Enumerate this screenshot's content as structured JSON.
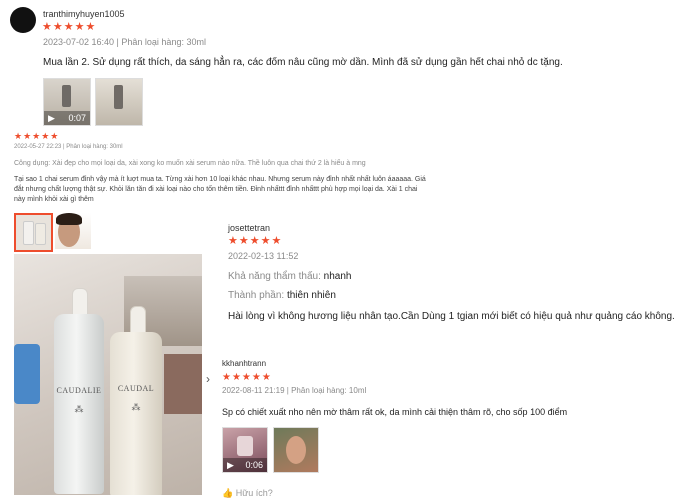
{
  "review1": {
    "username": "tranthimyhuyen1005",
    "stars": "★★★★★",
    "meta": "2023-07-02 16:40 | Phân loại hàng: 30ml",
    "text": "Mua lần 2. Sử dụng rất thích, da sáng hẳn ra, các đốm nâu cũng mờ dần. Mình đã sử dụng gần hết chai nhỏ dc tặng.",
    "video_duration": "0:07"
  },
  "review2": {
    "stars": "★★★★★",
    "meta": "2022-05-27 22:23 | Phân loại hàng: 30ml",
    "line1": "Công dụng: Xài đẹp cho mọi loại da, xài xong ko muốn xài serum nào nữa. Thề luôn qua chai thứ 2 là hiểu à mng",
    "line2": "Tại sao 1 chai serum đỉnh vậy mà ít luợt mua ta. Từng xài hơn 10 loại khác nhau. Nhưng serum này đỉnh nhất nhất luôn áaaaaa. Giá",
    "line3": "đắt nhưng chất lượng thật sự. Khỏi lăn tăn đi xài loại nào cho tốn thêm tiền. Đỉnh nhấttt đỉnh nhấttt phù hợp mọi loại da. Xài 1 chai",
    "line4": "này mình khỏi xài gì thêm",
    "product_brand": "CAUDALIE",
    "product_brand2": "CAUDAL"
  },
  "review3": {
    "username": "josettetran",
    "stars": "★★★★★",
    "date": "2022-02-13 11:52",
    "absorb_label": "Khả năng thẩm thấu:",
    "absorb_value": "nhanh",
    "ingredient_label": "Thành phần:",
    "ingredient_value": "thiên nhiên",
    "text": "Hài lòng vì không hương liệu nhân tạo.Cần Dùng 1 tgian mới biết có hiệu quả như quảng cáo không."
  },
  "review4": {
    "username": "kkhanhtrann",
    "stars": "★★★★★",
    "meta": "2022-08-11 21:19 | Phân loại hàng: 10ml",
    "text": "Sp có chiết xuất nho nên mờ thâm rất ok, da mình cải thiện thâm rõ, cho sốp 100 điểm",
    "video_duration": "0:06",
    "helpful_label": "Hữu ích?"
  },
  "gallery": {
    "next_arrow": "›"
  },
  "colors": {
    "star": "#ee4d2d"
  }
}
